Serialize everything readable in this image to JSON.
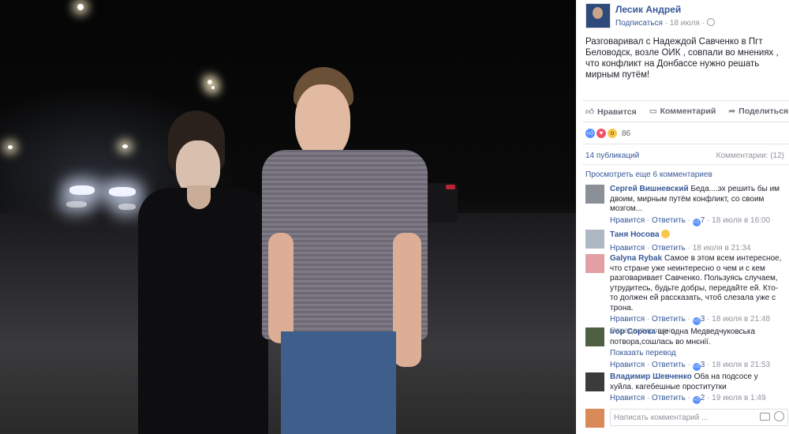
{
  "post": {
    "author": "Лесик Андрей",
    "subscribe": "Подписаться",
    "dot": "·",
    "date": "18 июля",
    "privacy_icon": "globe-icon",
    "text": "Разговаривал с Надеждой Савченко в Пгт Беловодск, возле ОИК , совпали во мнениях , что конфликт на Донбассе нужно решать мирным путём!"
  },
  "actions": {
    "like": "Нравится",
    "comment": "Комментарий",
    "share": "Поделиться"
  },
  "reactions": {
    "count": "86",
    "types": [
      "like",
      "love",
      "wow"
    ]
  },
  "stats": {
    "shares": "14 публикаций",
    "comments": "Комментарии: (12)"
  },
  "more_comments": "Просмотреть еще 6 комментариев",
  "comments": [
    {
      "name": "Сергей Вишневский",
      "text": "Беда....эх решить бы им двоим, мирным путём конфликт, со своим мозгом...",
      "like": "Нравится",
      "reply": "Ответить",
      "likes": "7",
      "time": "18 июля в 16:00",
      "extra": ""
    },
    {
      "name": "Таня Носова",
      "text": "",
      "like": "Нравится",
      "reply": "Ответить",
      "likes": "",
      "time": "18 июля в 21:34",
      "extra": ""
    },
    {
      "name": "Galyna Rybak",
      "text": "Самое в этом всем интересное, что стране уже неинтересно о чем и с кем разговаривает Савченко. Пользуясь случаем, утрудитесь, будьте добры, передайте ей. Кто-то должен ей рассказать, чтоб слезала уже с трона.",
      "like": "Нравится",
      "reply": "Ответить",
      "likes": "3",
      "time": "18 июля в 21:48",
      "extra": "Отредактировано"
    },
    {
      "name": "Ігор Сорока",
      "text": "ще одна Медведчуковська потвора,сошлась во мнєнії.",
      "like": "Нравится",
      "reply": "Ответить",
      "likes": "3",
      "time": "18 июля в 21:53",
      "extra": "Показать перевод"
    },
    {
      "name": "Владимир Шевченко",
      "text": "Оба на подсосе у хуйла. кагебешные проститутки",
      "like": "Нравится",
      "reply": "Ответить",
      "likes": "2",
      "time": "19 июля в 1:49",
      "extra": ""
    }
  ],
  "compose": {
    "placeholder": "Написать комментарий ..."
  },
  "separator": "·"
}
